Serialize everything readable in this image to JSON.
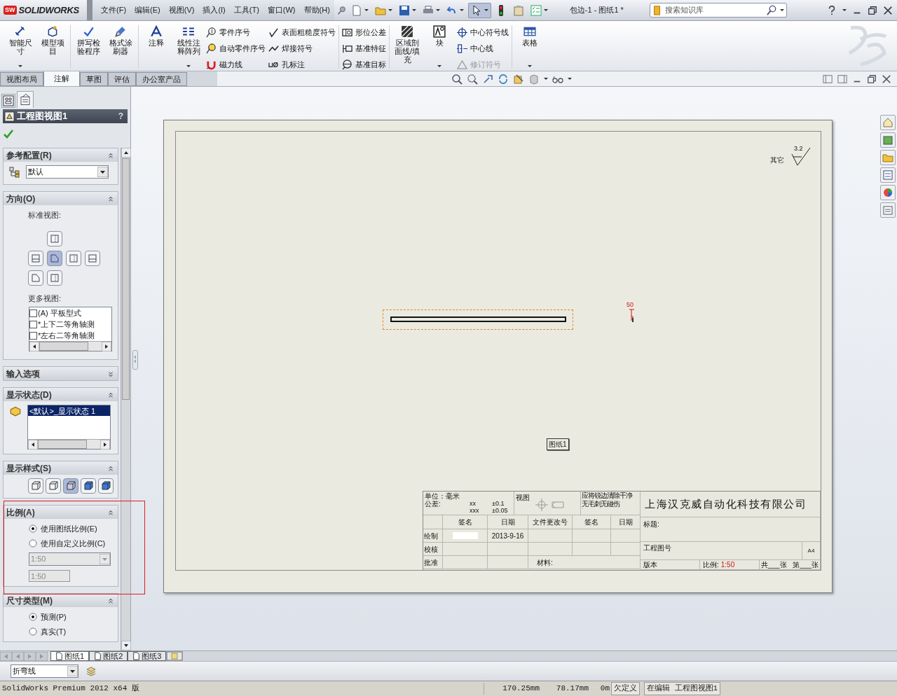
{
  "app_logo": {
    "badge": "SW",
    "wordmark": "SOLIDWORKS"
  },
  "menu": [
    "文件(F)",
    "编辑(E)",
    "视图(V)",
    "插入(I)",
    "工具(T)",
    "窗口(W)",
    "帮助(H)"
  ],
  "document_title": "包边-1 - 图纸1 *",
  "search": {
    "placeholder": "搜索知识库"
  },
  "ribbon": [
    {
      "entries": [
        {
          "kind": "large",
          "label": "智能尺寸",
          "dropdown": true
        },
        {
          "kind": "large",
          "label": "模型项目",
          "dropdown": false
        }
      ]
    },
    {
      "entries": [
        {
          "kind": "large",
          "label": "拼写检验程序",
          "dropdown": false
        },
        {
          "kind": "large",
          "label": "格式涂刷器",
          "dropdown": false
        }
      ]
    },
    {
      "entries": [
        {
          "kind": "large",
          "label": "注释",
          "dropdown": false
        },
        {
          "kind": "large",
          "label": "线性注释阵列",
          "dropdown": true
        },
        {
          "kind": "stack",
          "items": [
            {
              "label": "零件序号",
              "disabled": false
            },
            {
              "label": "自动零件序号",
              "disabled": false
            },
            {
              "label": "磁力线",
              "disabled": false
            }
          ]
        },
        {
          "kind": "stack",
          "items": [
            {
              "label": "表面粗糙度符号",
              "disabled": false
            },
            {
              "label": "焊接符号",
              "disabled": false
            },
            {
              "label": "孔标注",
              "disabled": false
            }
          ]
        }
      ]
    },
    {
      "entries": [
        {
          "kind": "stack",
          "items": [
            {
              "label": "形位公差",
              "disabled": false
            },
            {
              "label": "基准特征",
              "disabled": false
            },
            {
              "label": "基准目标",
              "disabled": false
            }
          ]
        }
      ]
    },
    {
      "entries": [
        {
          "kind": "large",
          "label": "区域剖面线/填充",
          "dropdown": false
        },
        {
          "kind": "large",
          "label": "块",
          "dropdown": true
        },
        {
          "kind": "stack",
          "items": [
            {
              "label": "中心符号线",
              "disabled": false
            },
            {
              "label": "中心线",
              "disabled": false
            },
            {
              "label": "修订符号",
              "disabled": true
            }
          ]
        }
      ]
    },
    {
      "entries": [
        {
          "kind": "large",
          "label": "表格",
          "dropdown": true
        }
      ]
    }
  ],
  "command_tabs": [
    {
      "label": "视图布局",
      "selected": false
    },
    {
      "label": "注解",
      "selected": true
    },
    {
      "label": "草图",
      "selected": false
    },
    {
      "label": "评估",
      "selected": false
    },
    {
      "label": "办公室产品",
      "selected": false
    }
  ],
  "property_manager": {
    "title": "工程图视图1",
    "help": "?",
    "sections": [
      {
        "kind": "config",
        "title": "参考配置(R)",
        "expanded": true,
        "value": "默认"
      },
      {
        "kind": "orientation",
        "title": "方向(O)",
        "expanded": true,
        "standard_label": "标准视图:",
        "views": [
          [
            {
              "selected": false
            }
          ],
          [
            {
              "selected": false
            },
            {
              "selected": true
            },
            {
              "selected": false
            },
            {
              "selected": false
            }
          ],
          [
            {
              "selected": false
            },
            {
              "selected": false
            }
          ]
        ],
        "more_label": "更多视图:",
        "more_views": [
          {
            "label": "(A) 平板型式",
            "checked": false
          },
          {
            "label": "*上下二等角轴测",
            "checked": false
          },
          {
            "label": "*左右二等角轴测",
            "checked": false
          }
        ]
      },
      {
        "kind": "collapsed",
        "title": "输入选项",
        "expanded": false
      },
      {
        "kind": "display_state",
        "title": "显示状态(D)",
        "expanded": true,
        "items": [
          {
            "label": "<默认>_显示状态 1",
            "selected": true
          }
        ]
      },
      {
        "kind": "display_style",
        "title": "显示样式(S)",
        "expanded": true,
        "styles": [
          {
            "selected": false
          },
          {
            "selected": false
          },
          {
            "selected": true
          },
          {
            "selected": false
          },
          {
            "selected": false
          }
        ]
      },
      {
        "kind": "scale",
        "title": "比例(A)",
        "expanded": true,
        "options": [
          {
            "label": "使用图纸比例(E)",
            "selected": true
          },
          {
            "label": "使用自定义比例(C)",
            "selected": false
          }
        ],
        "preset": {
          "value": "1:50",
          "disabled": true
        },
        "custom": {
          "value": "1:50",
          "disabled": true
        }
      },
      {
        "kind": "radios",
        "title": "尺寸类型(M)",
        "expanded": true,
        "options": [
          {
            "label": "预测(P)",
            "selected": true
          },
          {
            "label": "真实(T)",
            "selected": false
          }
        ]
      }
    ]
  },
  "drawing": {
    "surface_finish": {
      "label": "其它",
      "value": "3.2"
    },
    "dimension_label": "50",
    "sheet_label": "图纸1",
    "title_block": {
      "unit": "单位：毫米",
      "tolerance_label": "公差:",
      "tolerances": [
        {
          "spec": "xx",
          "value": "±0.1"
        },
        {
          "spec": "xxx",
          "value": "±0.05"
        }
      ],
      "view_label": "视图",
      "note": [
        "应将锐边清除干净",
        "无毛刺无碰伤"
      ],
      "columns": [
        "签名",
        "日期",
        "文件更改号",
        "签名",
        "日期"
      ],
      "rows": [
        {
          "label": "绘制",
          "redacted": true,
          "date": "2013-9-16"
        },
        {
          "label": "校核",
          "redacted": false
        },
        {
          "label": "批准",
          "redacted": false,
          "material_label": "材料:"
        }
      ],
      "company": "上海汉克威自动化科技有限公司",
      "title_label": "标题:",
      "drawing_no_label": "工程图号",
      "size": "A4",
      "version_label": "版本",
      "scale_label": "比例:",
      "scale": "1:50",
      "sheet_total": "共___张",
      "sheet_number": "第___张"
    }
  },
  "sheet_tabs": [
    {
      "label": "图纸1",
      "selected": true
    },
    {
      "label": "图纸2",
      "selected": false
    },
    {
      "label": "图纸3",
      "selected": false
    }
  ],
  "line_style": {
    "value": "折弯线"
  },
  "status_bar": {
    "product": "SolidWorks Premium 2012 x64 版",
    "x": "170.25mm",
    "y": "78.17mm",
    "z": "0m",
    "state": "欠定义",
    "mode": "在编辑 工程图视图1"
  }
}
